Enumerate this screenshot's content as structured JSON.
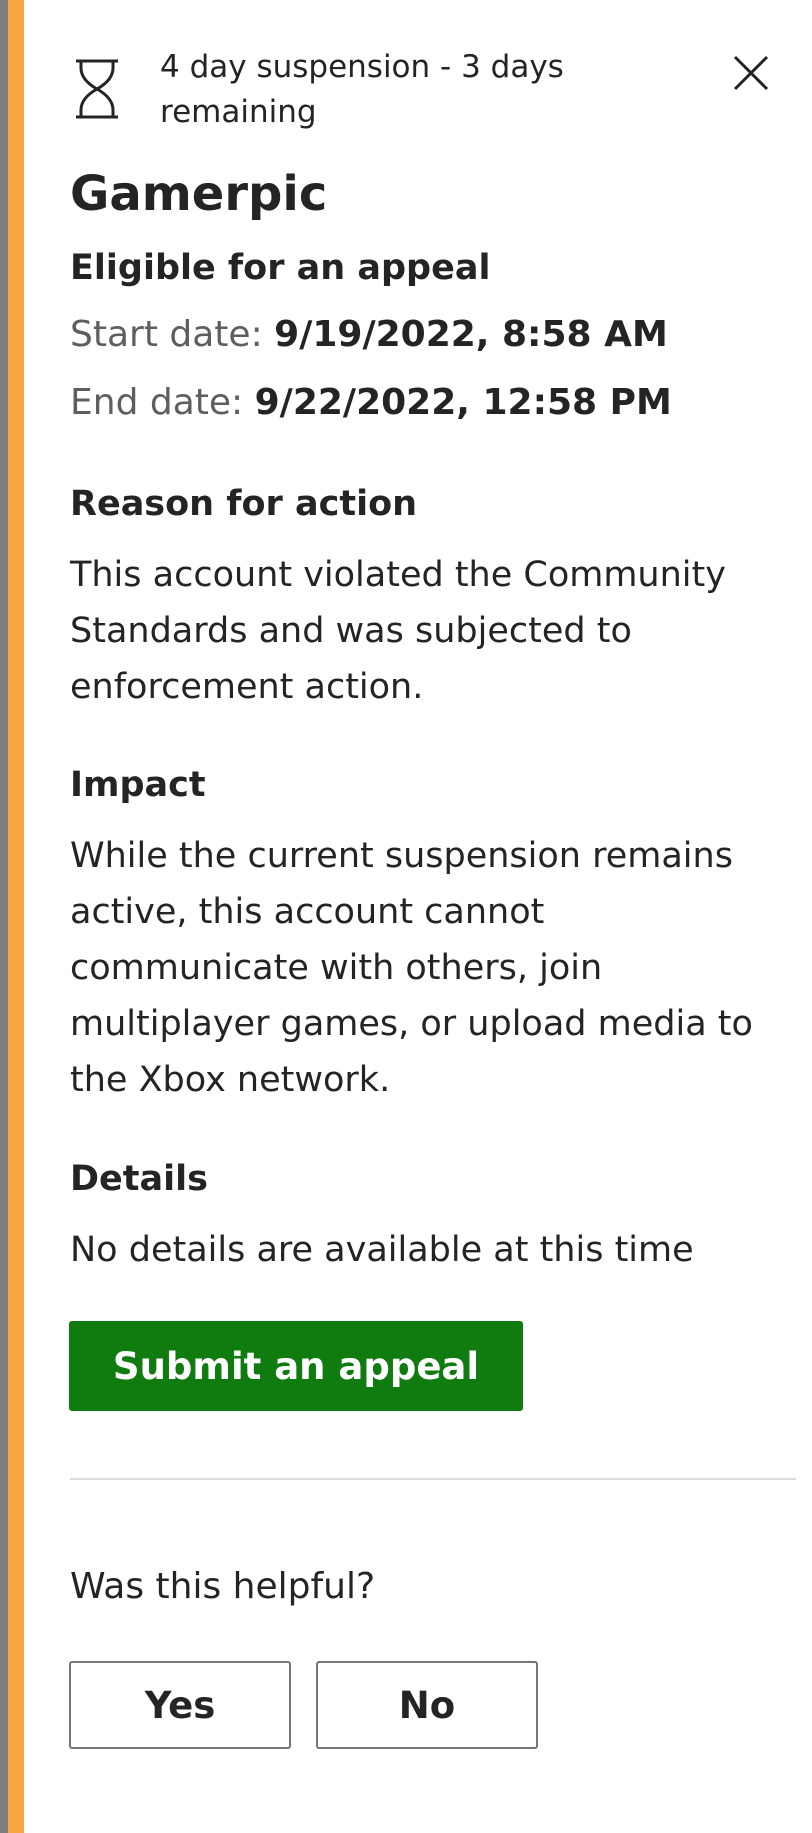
{
  "header": {
    "status": "4 day suspension - 3 days remaining",
    "status_icon": "hourglass-icon",
    "close_icon": "close-icon"
  },
  "title": "Gamerpic",
  "appeal_status": "Eligible for an appeal",
  "dates": {
    "start_label": "Start date:",
    "start_value": "9/19/2022, 8:58 AM",
    "end_label": "End date:",
    "end_value": "9/22/2022, 12:58 PM"
  },
  "sections": {
    "reason_heading": "Reason for action",
    "reason_body": "This account violated the Community Standards and was subjected to enforcement action.",
    "impact_heading": "Impact",
    "impact_body": "While the current suspension remains active, this account cannot communicate with others, join multiplayer games, or upload media to the Xbox network.",
    "details_heading": "Details",
    "details_body": "No details are available at this time"
  },
  "actions": {
    "submit_label": "Submit an appeal"
  },
  "feedback": {
    "question": "Was this helpful?",
    "yes_label": "Yes",
    "no_label": "No"
  },
  "colors": {
    "accent": "#f7a543",
    "primary_button": "#107c10"
  }
}
